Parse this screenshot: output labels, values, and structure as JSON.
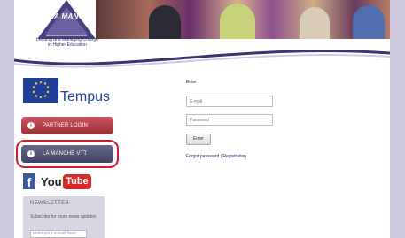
{
  "branding": {
    "logo_title": "LA MANCHE",
    "tagline_line1": "Leading and Managing Change",
    "tagline_line2": "in Higher Education"
  },
  "sidebar": {
    "tempus_label": "Tempus",
    "partner_login_label": "PARTNER LOGIN",
    "la_manche_vtt_label": "LA MANCHE VTT",
    "facebook_label": "f",
    "youtube_you": "You",
    "youtube_tube": "Tube",
    "newsletter": {
      "title": "NEWSLETTER",
      "text": "Subscribe for more news updates",
      "input_placeholder": "enter your e-mail here..."
    }
  },
  "login": {
    "heading": "Enter",
    "email_placeholder": "E-mail",
    "password_placeholder": "Password",
    "submit_label": "Enter",
    "forgot_password": "Forgot password",
    "separator": " | ",
    "registration": "Registration"
  },
  "colors": {
    "frame": "#cfc9e0",
    "partner_button": "#b03e4a",
    "vtt_button": "#4e5170",
    "highlight": "#cc1f2e",
    "tempus_blue": "#1f3f9a"
  }
}
